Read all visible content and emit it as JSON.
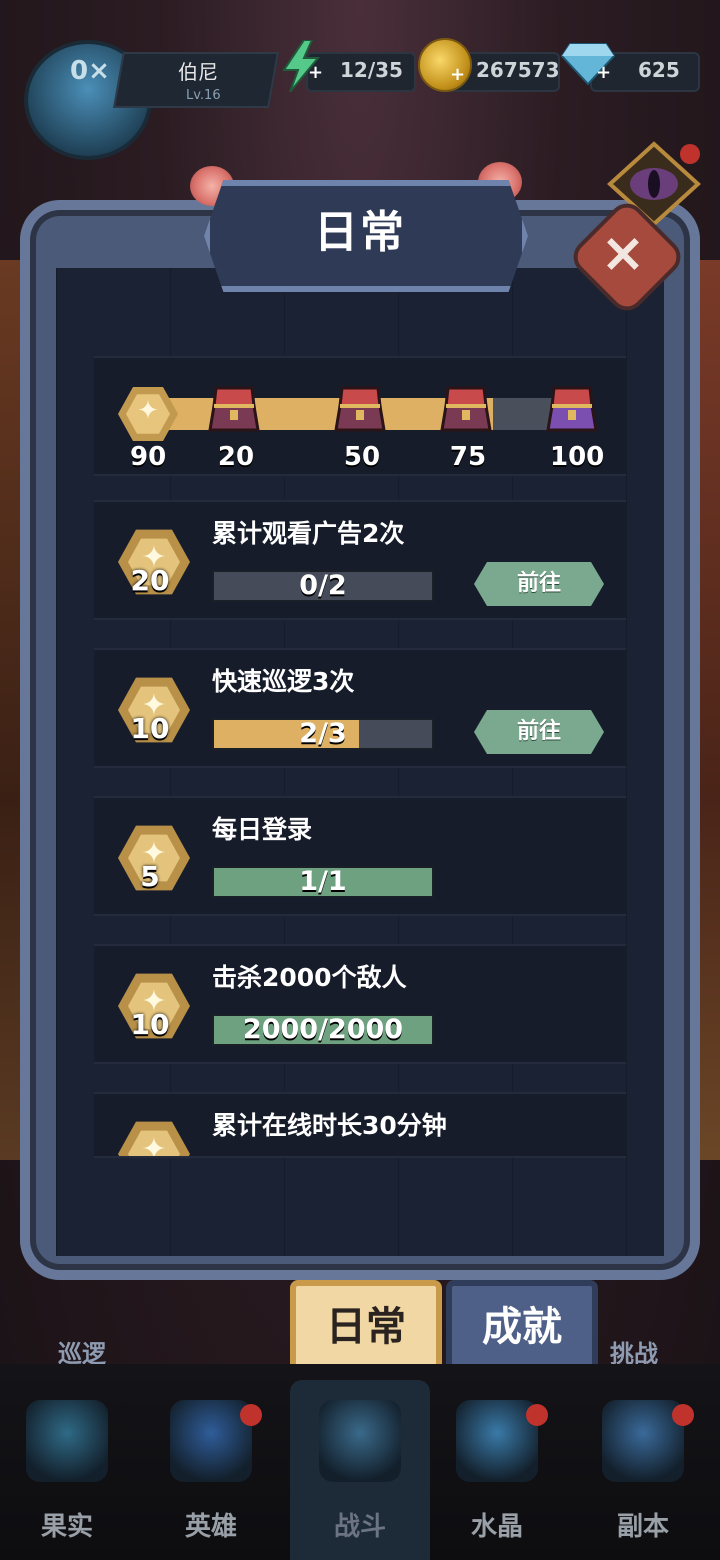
{
  "player": {
    "avatar_text": "0×",
    "name": "伯尼",
    "level": "Lv.16"
  },
  "resources": {
    "energy": "12/35",
    "gold": "267573",
    "gems": "625"
  },
  "panel": {
    "title": "日常",
    "close_icon": "close-icon"
  },
  "milestones": {
    "current_points": "90",
    "progress": 0.9,
    "stops": [
      {
        "label": "20",
        "value": 20
      },
      {
        "label": "50",
        "value": 50
      },
      {
        "label": "75",
        "value": 75
      },
      {
        "label": "100",
        "value": 100
      }
    ]
  },
  "tasks": [
    {
      "points": "20",
      "title": "累计观看广告2次",
      "progress_text": "0/2",
      "progress": 0.0,
      "bar_color": "#454b58",
      "button": "前往"
    },
    {
      "points": "10",
      "title": "快速巡逻3次",
      "progress_text": "2/3",
      "progress": 0.667,
      "bar_color": "#ddb064",
      "button": "前往"
    },
    {
      "points": "5",
      "title": "每日登录",
      "progress_text": "1/1",
      "progress": 1.0,
      "bar_color": "#6da180"
    },
    {
      "points": "10",
      "title": "击杀2000个敌人",
      "progress_text": "2000/2000",
      "progress": 1.0,
      "bar_color": "#6da180"
    },
    {
      "title": "累计在线时长30分钟"
    }
  ],
  "tabs": {
    "daily": "日常",
    "achievement": "成就"
  },
  "side_labels": {
    "left": "巡逻",
    "right": "挑战"
  },
  "nav": [
    {
      "label": "果实",
      "icon": "fruit-icon",
      "dot": false
    },
    {
      "label": "英雄",
      "icon": "hero-icon",
      "dot": true
    },
    {
      "label": "战斗",
      "icon": "battle-icon",
      "dot": false
    },
    {
      "label": "水晶",
      "icon": "crystal-icon",
      "dot": true
    },
    {
      "label": "副本",
      "icon": "dungeon-icon",
      "dot": true
    }
  ]
}
